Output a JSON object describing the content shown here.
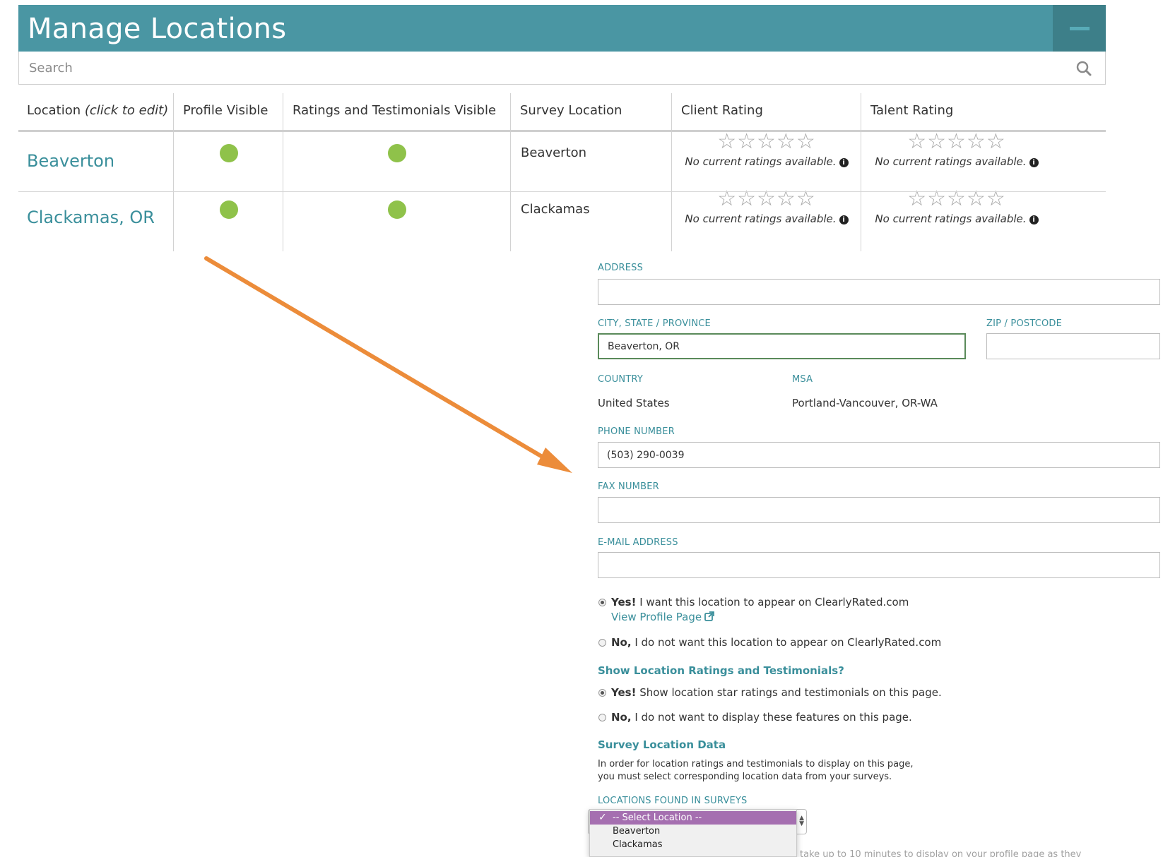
{
  "header": {
    "title": "Manage Locations"
  },
  "search": {
    "placeholder": "Search"
  },
  "table": {
    "headers": {
      "location": "Location",
      "location_hint": "(click to edit)",
      "profile_visible": "Profile Visible",
      "ratings_visible": "Ratings and Testimonials Visible",
      "survey_location": "Survey Location",
      "client_rating": "Client Rating",
      "talent_rating": "Talent Rating"
    },
    "rows": [
      {
        "location": "Beaverton",
        "profile_visible": true,
        "ratings_visible": true,
        "survey_location": "Beaverton",
        "client_rating": "No current ratings available.",
        "talent_rating": "No current ratings available."
      },
      {
        "location": "Clackamas, OR",
        "profile_visible": true,
        "ratings_visible": true,
        "survey_location": "Clackamas",
        "client_rating": "No current ratings available.",
        "talent_rating": "No current ratings available."
      }
    ],
    "star_glyphs": "☆☆☆☆☆"
  },
  "form": {
    "address_label": "Address",
    "address_value": "",
    "city_label": "City, State / Province",
    "city_value": "Beaverton, OR",
    "zip_label": "ZIP / Postcode",
    "zip_value": "",
    "country_label": "Country",
    "country_value": "United States",
    "msa_label": "MSA",
    "msa_value": "Portland-Vancouver, OR-WA",
    "phone_label": "Phone Number",
    "phone_value": "(503) 290-0039",
    "fax_label": "Fax Number",
    "fax_value": "",
    "email_label": "E-mail Address",
    "email_value": "",
    "profile_yes_bold": "Yes!",
    "profile_yes_text": " I want this location to appear on ClearlyRated.com",
    "view_profile_link": "View Profile Page",
    "profile_no_bold": "No,",
    "profile_no_text": " I do not want this location to appear on ClearlyRated.com",
    "ratings_section_title": "Show Location Ratings and Testimonials?",
    "ratings_yes_bold": "Yes!",
    "ratings_yes_text": " Show location star ratings and testimonials on this page.",
    "ratings_no_bold": "No,",
    "ratings_no_text": " I do not want to display these features on this page.",
    "survey_section_title": "Survey Location Data",
    "survey_para_1": "In order for location ratings and testimonials to display on this page,",
    "survey_para_2": "you must select corresponding location data from your surveys.",
    "locations_found_label": "Locations Found in Surveys",
    "note_partial": "take up to 10 minutes to display on your profile page as they",
    "dropdown_options": [
      "-- Select Location --",
      "Beaverton",
      "Clackamas"
    ],
    "dropdown_selected_index": 0
  },
  "colors": {
    "header_bg": "#4a96a3",
    "accent": "#3a8f9b",
    "visible_dot": "#8fc24a",
    "arrow": "#ec8c3a",
    "dropdown_highlight": "#a56fb0"
  }
}
